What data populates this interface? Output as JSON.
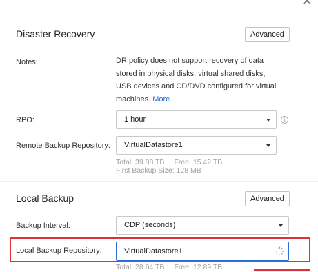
{
  "dr": {
    "title": "Disaster Recovery",
    "advanced_label": "Advanced",
    "notes_label": "Notes:",
    "notes_text": "DR policy does not support recovery of data stored in physical disks, virtual shared disks, USB devices and CD/DVD configured for virtual machines.",
    "more_link": "More",
    "rpo_label": "RPO:",
    "rpo_value": "1 hour",
    "remote_repo_label": "Remote Backup Repository:",
    "remote_repo_value": "VirtualDatastore1",
    "remote_total": "Total: 39.88 TB",
    "remote_free": "Free: 15.42 TB",
    "first_backup_size": "First Backup Size: 128 MB"
  },
  "local": {
    "title": "Local Backup",
    "advanced_label": "Advanced",
    "interval_label": "Backup Interval:",
    "interval_value": "CDP (seconds)",
    "repo_label": "Local Backup Repository:",
    "repo_value": "VirtualDatastore1",
    "total": "Total: 28.64 TB",
    "free": "Free: 12.89 TB"
  },
  "colors": {
    "accent": "#1e6fd9",
    "focus_border": "#2f6fd8",
    "highlight": "#e0303a",
    "muted_text": "#a0a0a0"
  },
  "icons": {
    "close": "close-icon",
    "info": "info-icon",
    "loading": "loading-spinner-icon",
    "dropdown": "chevron-down-icon"
  }
}
